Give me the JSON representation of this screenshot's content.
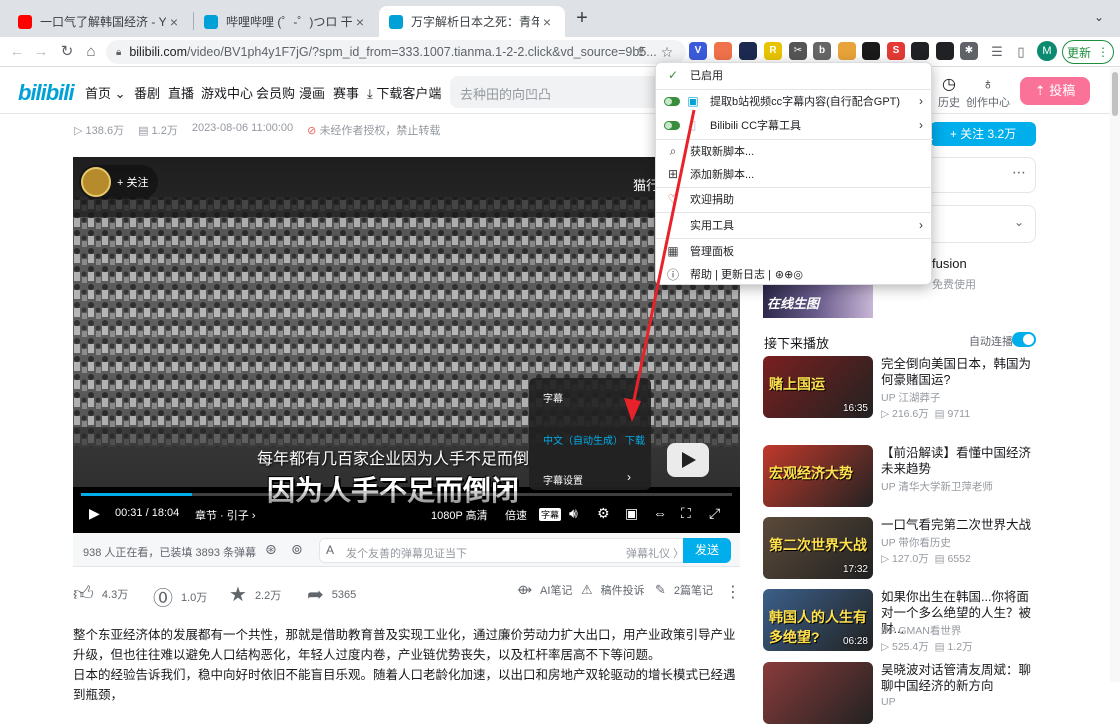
{
  "browser": {
    "tabs": [
      {
        "title": "一口气了解韩国经济 - YouTube",
        "color": "#ff0000"
      },
      {
        "title": "哔哩哔哩 (゜-゜)つロ 干杯~-bilibili",
        "color": "#00a1d6"
      },
      {
        "title": "万字解析日本之死：青年失业、机",
        "color": "#00a1d6"
      }
    ],
    "address": {
      "host": "bilibili.com",
      "path": "/video/BV1ph4y1F7jG/?spm_id_from=333.1007.tianma.1-2-2.click&vd_source=9b5..."
    },
    "extensions": [
      {
        "name": "vivaldi-icon",
        "glyph": "V",
        "color": "#3b5bdb"
      },
      {
        "name": "extension-icon",
        "glyph": "",
        "color": "#f0724b",
        "badge": "2"
      },
      {
        "name": "extension-icon",
        "glyph": "",
        "color": "#1c2a52"
      },
      {
        "name": "extension-icon",
        "glyph": "R",
        "color": "#e8c400"
      },
      {
        "name": "scissors-icon",
        "glyph": "✂",
        "color": "#555555"
      },
      {
        "name": "extension-icon",
        "glyph": "b",
        "color": "#666666"
      },
      {
        "name": "extension-icon",
        "glyph": "",
        "color": "#e8a33b"
      },
      {
        "name": "extension-icon",
        "glyph": "",
        "color": "#1a1a1a"
      },
      {
        "name": "extension-icon",
        "glyph": "S",
        "color": "#e53935"
      },
      {
        "name": "tampermonkey-icon",
        "glyph": "",
        "color": "#202124",
        "badge": "2"
      },
      {
        "name": "extension-icon",
        "glyph": "",
        "color": "#202124"
      },
      {
        "name": "puzzle-icon",
        "glyph": "✱",
        "color": "#5f6368"
      }
    ],
    "profile_initial": "M",
    "update_label": "更新"
  },
  "site": {
    "logo": "bilibili",
    "nav": [
      "首页",
      "番剧",
      "直播",
      "游戏中心",
      "会员购",
      "漫画",
      "赛事",
      "下载客户端"
    ],
    "search_placeholder": "去种田的向凹凸",
    "history": "历史",
    "creator": "创作中心",
    "post": "投稿"
  },
  "video": {
    "views": "138.6万",
    "danmaku": "1.2万",
    "date": "2023-08-06 11:00:00",
    "copyright": "未经作者授权，禁止转载",
    "follow_chip": "+ 关注",
    "watermark": "猫行",
    "subtitle_small": "每年都有几百家企业因为人手不足而倒",
    "subtitle_big": "因为人手不足而倒闭",
    "progress": 0.17,
    "time_current": "00:31",
    "time_total": "18:04",
    "chapter": "章节 · 引子",
    "quality": "1080P 高清",
    "speed": "倍速",
    "cc": "字幕",
    "sub_panel": {
      "title": "字幕",
      "lang": "中文（自动生成）",
      "download": "下载",
      "settings": "字幕设置"
    }
  },
  "danmaku_bar": {
    "count": "938 人正在看，已装填 3893 条弹幕",
    "placeholder": "发个友善的弹幕见证当下",
    "etiquette": "弹幕礼仪 〉",
    "send": "发送"
  },
  "actions": {
    "like": "4.3万",
    "coin": "1.0万",
    "fav": "2.2万",
    "share": "5365",
    "ai_note": "AI笔记",
    "report": "稿件投诉",
    "notes": "2篇笔记"
  },
  "description": [
    "整个东亚经济体的发展都有一个共性，那就是借助教育普及实现工业化，通过廉价劳动力扩大出口，用产业政策引导产业升级，但也往往难以避免人口结构恶化，年轻人过度内卷，产业链优势丧失，以及杠杆率居高不下等问题。",
    "日本的经验告诉我们，稳中向好时依旧不能盲目乐观。随着人口老龄化加速，以出口和房地产双轮驱动的增长模式已经遇到瓶颈，"
  ],
  "sidebar": {
    "follow": "+ 关注 3.2万",
    "ad_title": "fusion",
    "ad_sub": "免费使用",
    "ad_thumb_text": "在线生图",
    "next": "接下来播放",
    "autoplay": "自动连播",
    "recs": [
      {
        "title": "完全倒向美国日本，韩国为何豪赌国运?",
        "up": "江湖莽子",
        "views": "216.6万",
        "danmaku": "9711",
        "dur": "16:35",
        "thumb_text": "赌上国运",
        "bg": "#7a1f1f"
      },
      {
        "title": "【前沿解读】看懂中国经济未来趋势",
        "up": "清华大学新卫萍老师",
        "views": "",
        "danmaku": "",
        "dur": "",
        "thumb_text": "宏观经济大势",
        "bg": "#c0392b"
      },
      {
        "title": "一口气看完第二次世界大战",
        "up": "带你看历史",
        "views": "127.0万",
        "danmaku": "6552",
        "dur": "17:32",
        "thumb_text": "第二次世界大战",
        "bg": "#5b4a3a"
      },
      {
        "title": "如果你出生在韩国...你将面对一个多么绝望的人生？被财...",
        "up": "GMAN看世界",
        "views": "525.4万",
        "danmaku": "1.2万",
        "dur": "06:28",
        "thumb_text": "韩国人的人生有多绝望?",
        "bg": "#3b5f8a"
      },
      {
        "title": "吴晓波对话管清友周斌：聊聊中国经济的新方向",
        "up": "",
        "views": "",
        "danmaku": "",
        "dur": "",
        "thumb_text": "",
        "bg": "#8a3b3b"
      }
    ]
  },
  "script_menu": {
    "enabled": "已启用",
    "script1": "提取b站视频cc字幕内容(自行配合GPT)",
    "script2": "Bilibili CC字幕工具",
    "get_new": "获取新脚本...",
    "add_new": "添加新脚本...",
    "donate": "欢迎捐助",
    "utilities": "实用工具",
    "dashboard": "管理面板",
    "help": "帮助 | 更新日志 |"
  }
}
